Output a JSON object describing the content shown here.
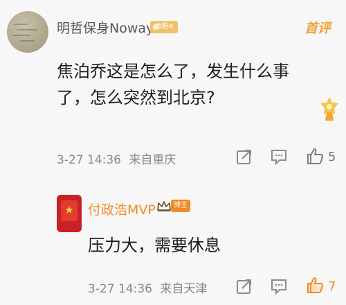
{
  "comment": {
    "username": "明哲保身Noway",
    "badge": "金粉4",
    "top_rated": "首评",
    "text": "焦泊乔这是怎么了，发生什么事了，怎么突然到北京?",
    "time": "3-27 14:36",
    "source": "来自重庆",
    "likes": "5"
  },
  "reply": {
    "username": "付政浩MVP",
    "badge": "博主",
    "text": "压力大，需要休息",
    "time": "3-27 14:36",
    "source": "来自天津",
    "likes": "7"
  },
  "colors": {
    "accent": "#f08a24",
    "gold": "#f1a23a",
    "muted": "#888888"
  },
  "icons": {
    "share": "share-icon",
    "reply": "comment-icon",
    "like": "thumb-up-icon"
  }
}
